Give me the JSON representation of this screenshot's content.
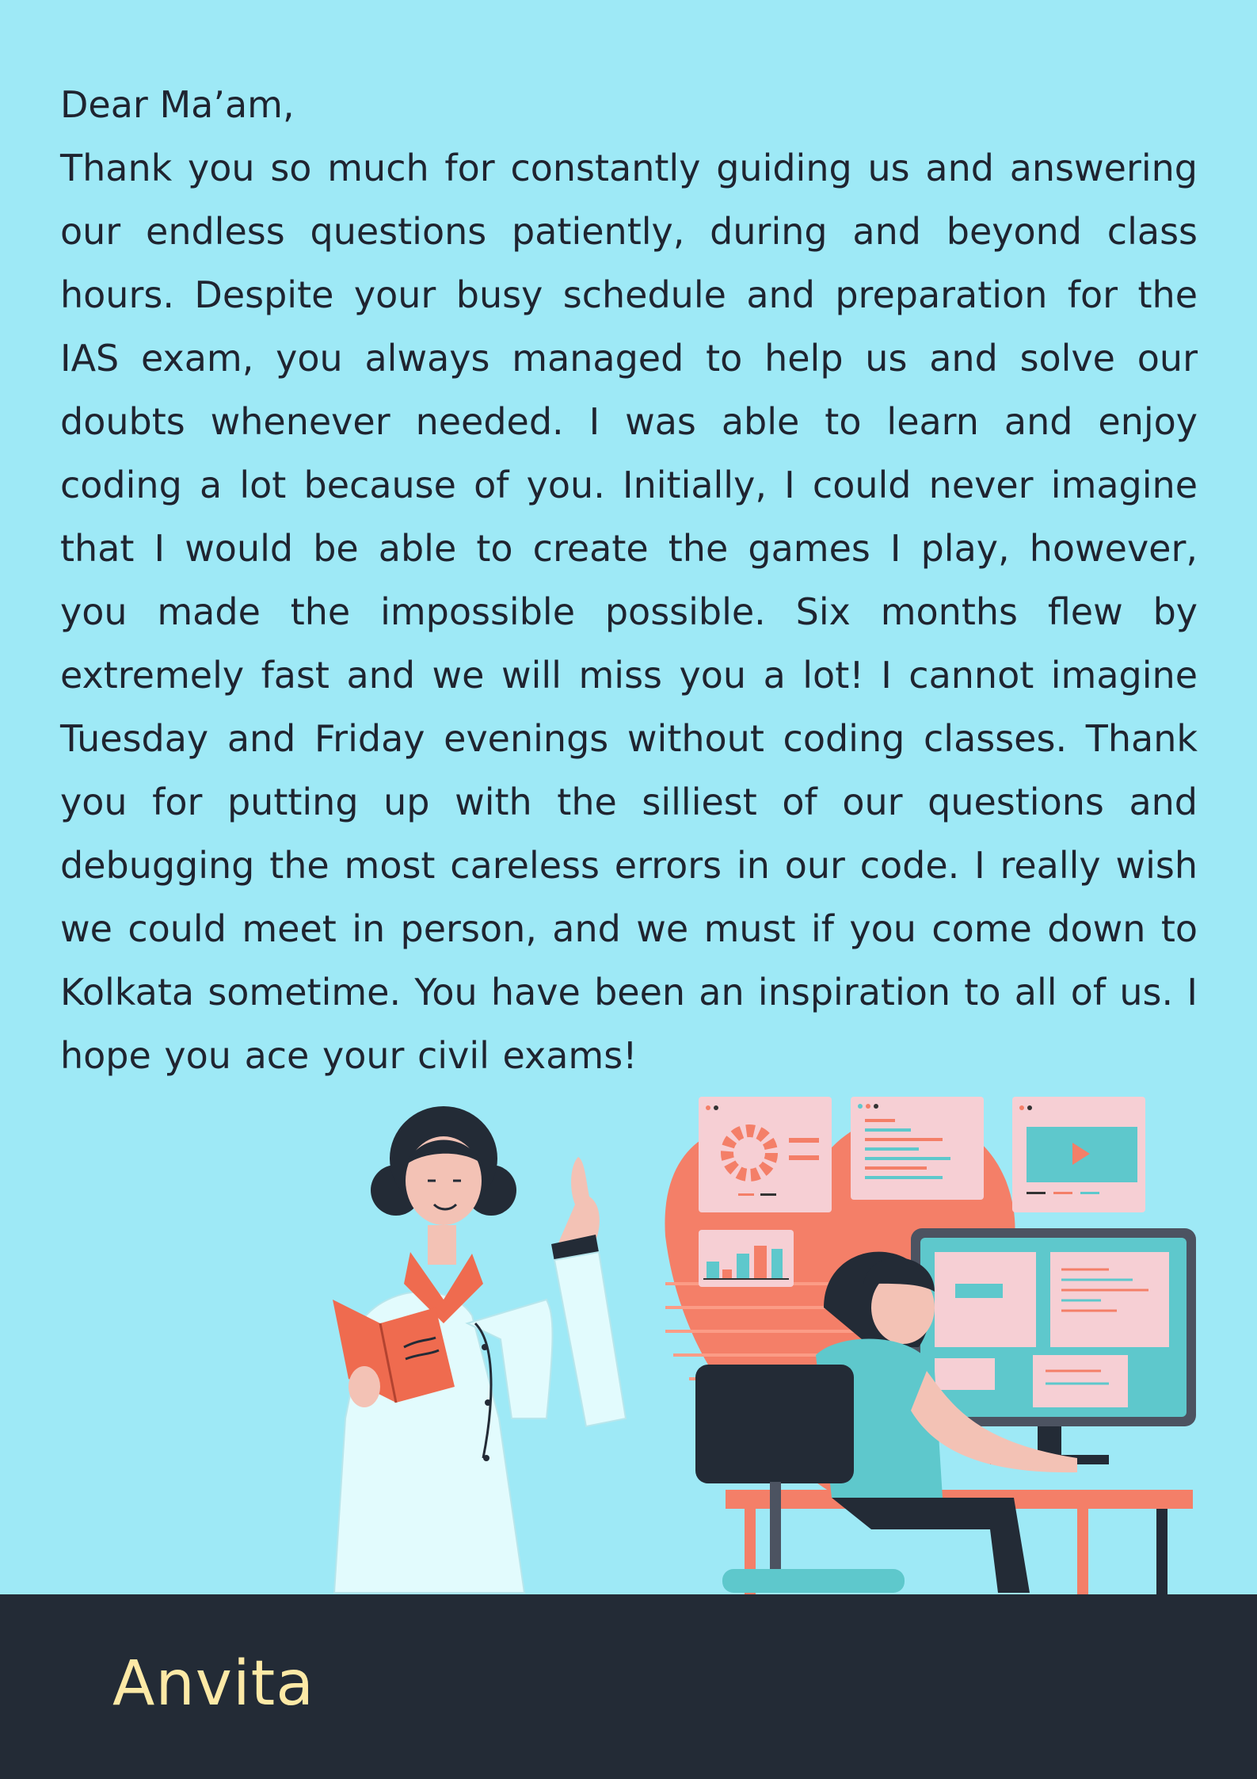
{
  "letter": {
    "greeting": "Dear Ma’am,",
    "body": "Thank you so much for constantly guiding us and answering our endless questions patiently, during and beyond class hours. Despite your busy schedule and preparation for the IAS exam, you always managed to help us and solve our doubts whenever needed. I was able to learn and enjoy coding a lot because of you. Initially, I could never imagine that I would be able to create the games I play, however, you made the impossible possible. Six months flew by extremely fast and we will miss you a lot! I cannot imagine Tuesday and Friday evenings without coding classes. Thank you for putting up with the silliest of our questions and debugging the most careless errors in our code. I really wish we could meet in person, and we must if you come down to Kolkata sometime. You have been an inspiration to all of us. I hope you ace your civil exams!"
  },
  "footer": {
    "signature": "Anvita"
  },
  "colors": {
    "background": "#9ee9f6",
    "footer": "#232b36",
    "signature": "#fde9a6",
    "accent_coral": "#f47f68",
    "accent_teal": "#5ec8cc"
  },
  "illustration": {
    "subjects": [
      "teacher-with-book-icon",
      "student-at-computer-icon",
      "code-windows-icon"
    ]
  }
}
